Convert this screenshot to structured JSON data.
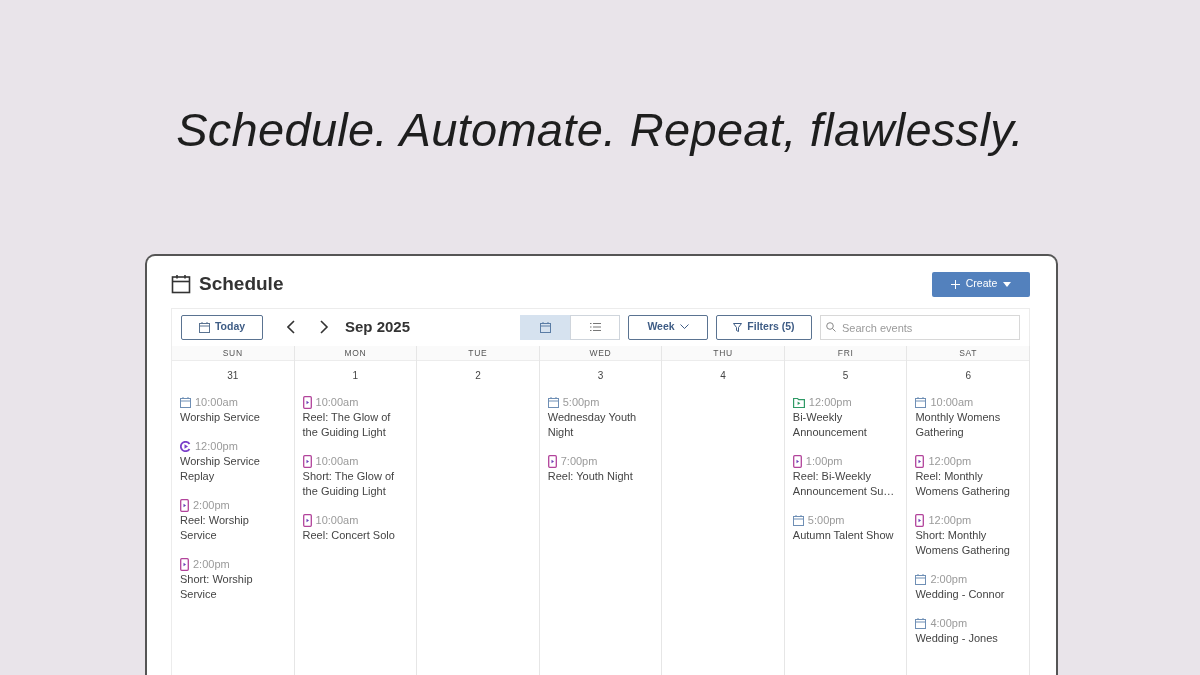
{
  "headline": "Schedule. Automate. Repeat, flawlessly.",
  "schedule": {
    "title": "Schedule",
    "create_button": "Create",
    "toolbar": {
      "today_button": "Today",
      "month_label": "Sep 2025",
      "view_toggle": [
        {
          "kind": "calendar",
          "selected": true
        },
        {
          "kind": "list",
          "selected": false
        }
      ],
      "range_dropdown": "Week",
      "filters_button": "Filters (5)",
      "search": {
        "placeholder": "Search events"
      }
    },
    "days": [
      {
        "name": "SUN",
        "date": "31",
        "events": [
          {
            "kind": "event",
            "time": "10:00am",
            "title": "Worship Service"
          },
          {
            "kind": "replay",
            "time": "12:00pm",
            "title": "Worship Service Replay"
          },
          {
            "kind": "video",
            "time": "2:00pm",
            "title": "Reel: Worship Service"
          },
          {
            "kind": "video",
            "time": "2:00pm",
            "title": "Short: Worship Service"
          }
        ]
      },
      {
        "name": "MON",
        "date": "1",
        "events": [
          {
            "kind": "video",
            "time": "10:00am",
            "title": "Reel: The Glow of the Guiding Light"
          },
          {
            "kind": "video",
            "time": "10:00am",
            "title": "Short: The Glow of the Guiding Light"
          },
          {
            "kind": "video",
            "time": "10:00am",
            "title": "Reel: Concert Solo"
          }
        ]
      },
      {
        "name": "TUE",
        "date": "2"
      },
      {
        "name": "WED",
        "date": "3",
        "events": [
          {
            "kind": "event",
            "time": "5:00pm",
            "title": "Wednesday Youth Night"
          },
          {
            "kind": "video",
            "time": "7:00pm",
            "title": "Reel: Youth Night"
          }
        ]
      },
      {
        "name": "THU",
        "date": "4"
      },
      {
        "name": "FRI",
        "date": "5",
        "events": [
          {
            "kind": "announcement",
            "time": "12:00pm",
            "title": "Bi-Weekly Announcement"
          },
          {
            "kind": "video",
            "time": "1:00pm",
            "title": "Reel: Bi-Weekly Announcement Su…"
          },
          {
            "kind": "event",
            "time": "5:00pm",
            "title": "Autumn Talent Show"
          }
        ]
      },
      {
        "name": "SAT",
        "date": "6",
        "events": [
          {
            "kind": "event",
            "time": "10:00am",
            "title": "Monthly Womens Gathering"
          },
          {
            "kind": "video",
            "time": "12:00pm",
            "title": "Reel: Monthly Womens Gathering"
          },
          {
            "kind": "video",
            "time": "12:00pm",
            "title": "Short: Monthly Womens Gathering"
          },
          {
            "kind": "event",
            "time": "2:00pm",
            "title": "Wedding - Connor"
          },
          {
            "kind": "event",
            "time": "4:00pm",
            "title": "Wedding - Jones"
          }
        ]
      }
    ]
  }
}
